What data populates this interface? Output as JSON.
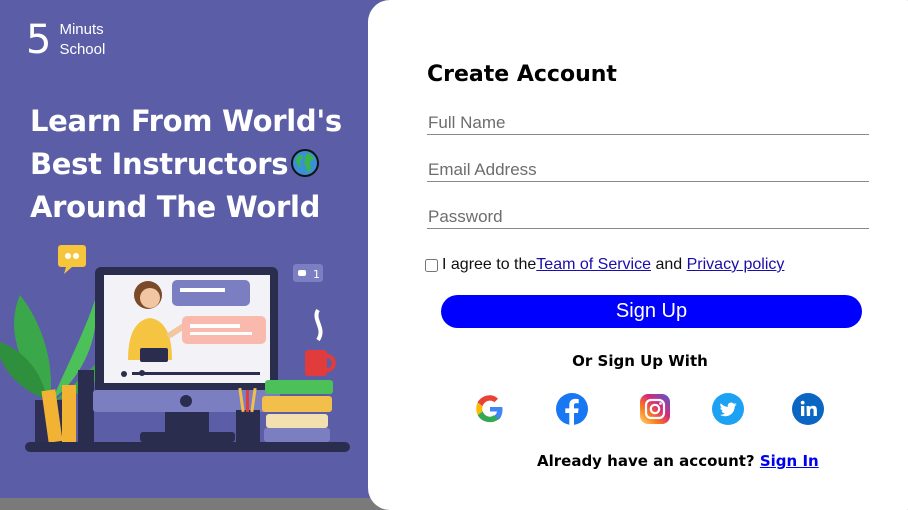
{
  "brand": {
    "number": "5",
    "line1": "Minuts",
    "line2": "School"
  },
  "hero": {
    "line1": "Learn From World's",
    "line2": "Best Instructors",
    "line3": "Around The World"
  },
  "form": {
    "title": "Create Account",
    "fullname_placeholder": "Full Name",
    "email_placeholder": "Email Address",
    "password_placeholder": "Password",
    "agree_text": "I agree to the",
    "terms_link": "Team of Service",
    "and_text": " and ",
    "privacy_link": "Privacy policy",
    "signup_label": "Sign Up",
    "or_text": "Or Sign Up With",
    "already_text": "Already have an account?",
    "signin_link": "Sign In"
  },
  "social": [
    {
      "icon": "google-icon"
    },
    {
      "icon": "facebook-icon"
    },
    {
      "icon": "instagram-icon"
    },
    {
      "icon": "twitter-icon"
    },
    {
      "icon": "linkedin-icon"
    }
  ],
  "illustration": {
    "chat_count": "1"
  },
  "colors": {
    "panel": "#5b5ea6",
    "accent": "#0000ff",
    "link": "#1a0dab"
  }
}
